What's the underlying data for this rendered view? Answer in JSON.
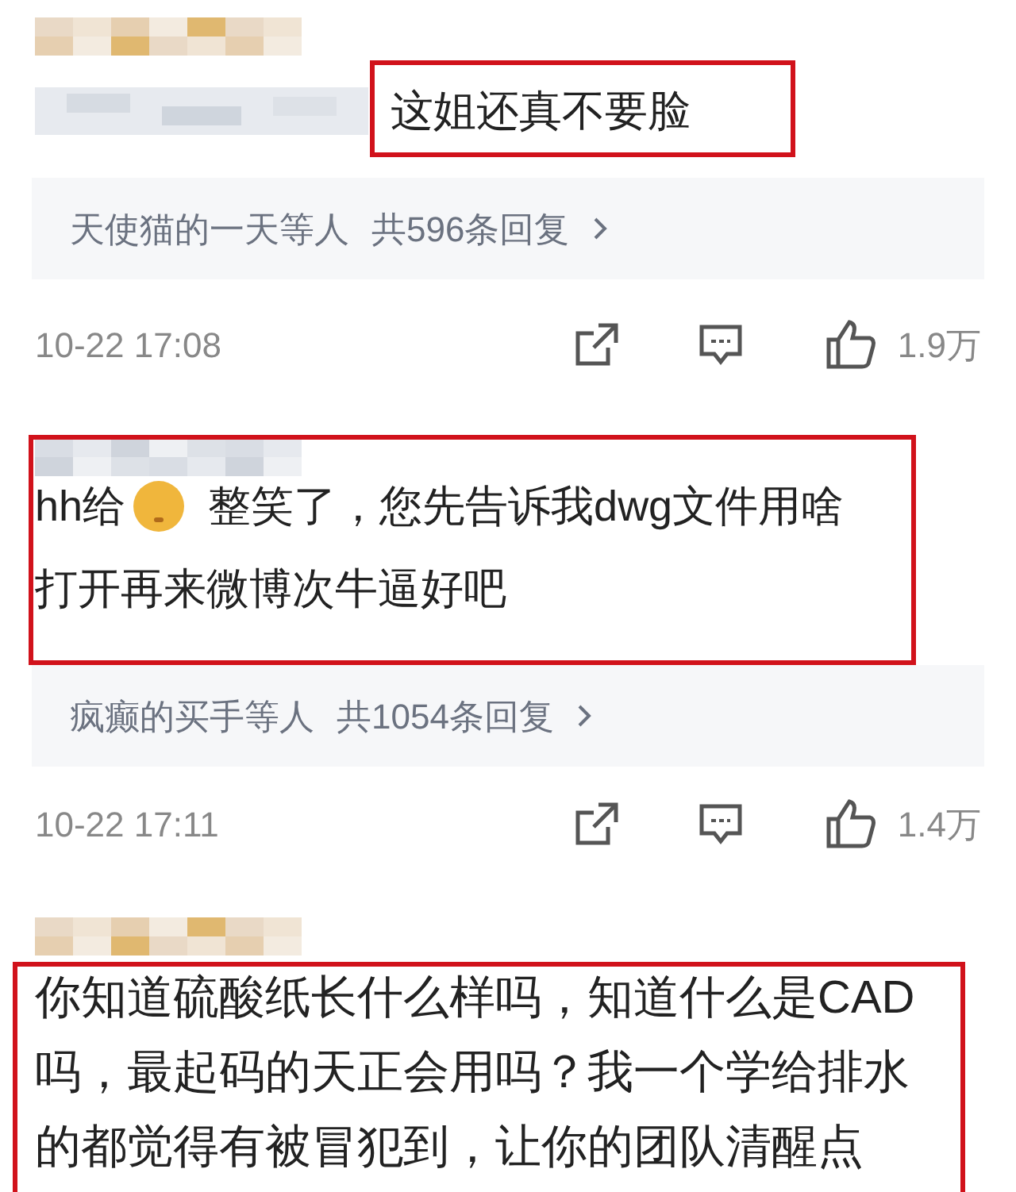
{
  "comments": [
    {
      "annotated": true,
      "content": [
        {
          "kind": "blur"
        },
        {
          "kind": "text",
          "text": "这姐还真不要脸"
        }
      ],
      "replies": {
        "names": "天使猫的一天等人",
        "count": "共596条回复"
      },
      "time": "10-22 17:08",
      "likes": "1.9万"
    },
    {
      "annotated": true,
      "content": [
        {
          "kind": "text",
          "text": "hh给"
        },
        {
          "kind": "emoji"
        },
        {
          "kind": "text",
          "text": "整笑了，您先告诉我dwg文件用啥"
        },
        {
          "kind": "break"
        },
        {
          "kind": "text",
          "text": "打开再来微博次牛逼好吧"
        }
      ],
      "replies": {
        "names": "疯癫的买手等人",
        "count": "共1054条回复"
      },
      "time": "10-22 17:11",
      "likes": "1.4万"
    },
    {
      "annotated": true,
      "content": [
        {
          "kind": "text",
          "text": "你知道硫酸纸长什么样吗，知道什么是CAD吗，最起码的天正会用吗？我一个学给排水的都觉得有被冒犯到，让你的团队清醒点"
        }
      ]
    }
  ]
}
